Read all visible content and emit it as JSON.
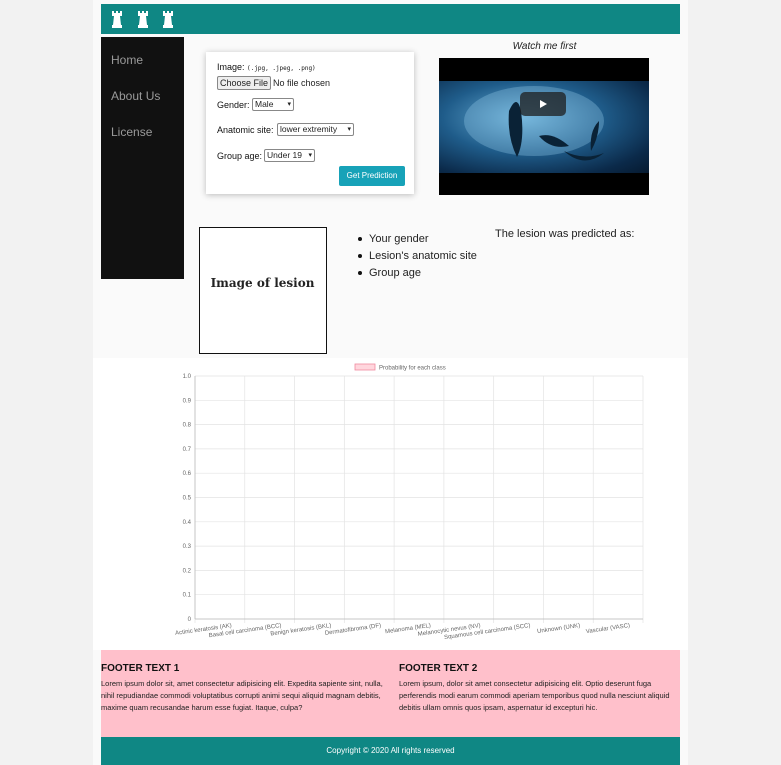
{
  "nav": {
    "items": [
      {
        "label": "Home"
      },
      {
        "label": "About Us"
      },
      {
        "label": "License"
      }
    ]
  },
  "form": {
    "image_label": "Image:",
    "image_hint": "(.jpg, .jpeg, .png)",
    "choose_file": "Choose File",
    "no_file": "No file chosen",
    "gender_label": "Gender:",
    "gender_value": "Male",
    "site_label": "Anatomic site:",
    "site_value": "lower extremity",
    "age_label": "Group age:",
    "age_value": "Under 19",
    "submit_label": "Get Prediction"
  },
  "video": {
    "title": "Watch me first"
  },
  "lesion": {
    "placeholder": "Image of lesion"
  },
  "info_list": [
    "Your gender",
    "Lesion's anatomic site",
    "Group age"
  ],
  "prediction_text": "The lesion was predicted as:",
  "chart_data": {
    "type": "bar",
    "legend": "Probability for each class",
    "legend_placement": "top-center",
    "categories": [
      "Actinic keratosis (AK)",
      "Basal cell carcinoma (BCC)",
      "Benign keratosis (BKL)",
      "Dermatofibroma (DF)",
      "Melanoma (MEL)",
      "Melanocytic nevus (NV)",
      "Squamous cell carcinoma (SCC)",
      "Unknown (UNK)",
      "Vascular (VASC)"
    ],
    "values": [
      0,
      0,
      0,
      0,
      0,
      0,
      0,
      0,
      0
    ],
    "yticks": [
      "0",
      "0.1",
      "0.2",
      "0.3",
      "0.4",
      "0.5",
      "0.6",
      "0.7",
      "0.8",
      "0.9",
      "1.0"
    ],
    "ylim": [
      0,
      1.0
    ],
    "grid": true,
    "colors": {
      "legend_fill": "#ffd6dd",
      "legend_border": "#f08aa0"
    }
  },
  "footer": {
    "col1_title": "FOOTER TEXT 1",
    "col1_text": "Lorem ipsum dolor sit, amet consectetur adipisicing elit. Expedita sapiente sint, nulla, nihil repudiandae commodi voluptatibus corrupti animi sequi aliquid magnam debitis, maxime quam recusandae harum esse fugiat. Itaque, culpa?",
    "col2_title": "FOOTER TEXT 2",
    "col2_text": "Lorem ipsum, dolor sit amet consectetur adipisicing elit. Optio deserunt fuga perferendis modi earum commodi aperiam temporibus quod nulla nesciunt aliquid debitis ullam omnis quos ipsam, aspernatur id excepturi hic.",
    "copyright": "Copyright © 2020 All rights reserved"
  },
  "theme": {
    "teal": "#0f8784",
    "pink": "#ffc0cb",
    "button": "#17a2b8",
    "sidebar": "#111111"
  }
}
